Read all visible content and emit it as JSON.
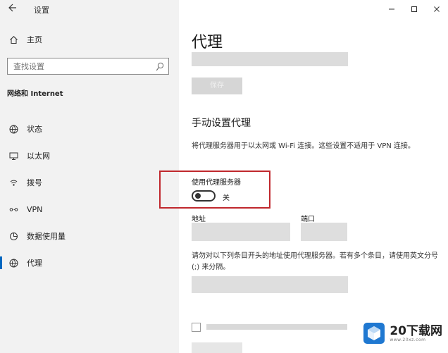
{
  "window": {
    "title": "设置"
  },
  "sidebar": {
    "home_label": "主页",
    "search_placeholder": "查找设置",
    "section_title": "网络和 Internet",
    "items": [
      {
        "label": "状态",
        "icon": "globe-icon"
      },
      {
        "label": "以太网",
        "icon": "monitor-icon"
      },
      {
        "label": "拨号",
        "icon": "dialup-icon"
      },
      {
        "label": "VPN",
        "icon": "vpn-icon"
      },
      {
        "label": "数据使用量",
        "icon": "pie-icon"
      },
      {
        "label": "代理",
        "icon": "globe-icon",
        "active": true
      }
    ]
  },
  "main": {
    "page_title": "代理",
    "manual_title": "手动设置代理",
    "description": "将代理服务器用于以太网或 Wi-Fi 连接。这些设置不适用于 VPN 连接。",
    "use_proxy_label": "使用代理服务器",
    "toggle_state": "关",
    "address_label": "地址",
    "port_label": "端口",
    "exceptions_text": "请勿对以下列条目开头的地址使用代理服务器。若有多个条目，请使用英文分号 (;) 来分隔。",
    "save_label": "保存"
  },
  "watermark": {
    "brand": "20下载网",
    "url": "www.20xz.com"
  },
  "colors": {
    "accent": "#0067c0",
    "highlight": "#c0282d"
  }
}
